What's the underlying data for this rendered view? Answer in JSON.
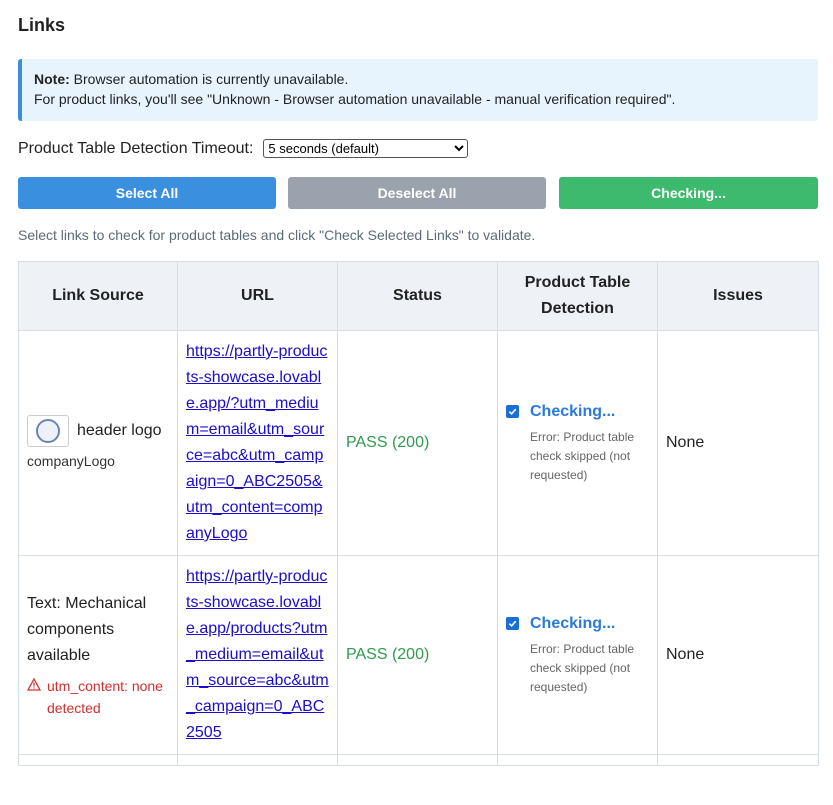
{
  "page": {
    "title": "Links"
  },
  "note": {
    "label": "Note:",
    "line1": "Browser automation is currently unavailable.",
    "line2": "For product links, you'll see \"Unknown - Browser automation unavailable - manual verification required\"."
  },
  "timeout": {
    "label": "Product Table Detection Timeout:",
    "selected": "5 seconds (default)"
  },
  "buttons": {
    "select_all": "Select All",
    "deselect_all": "Deselect All",
    "check": "Checking..."
  },
  "hint": "Select links to check for product tables and click \"Check Selected Links\" to validate.",
  "colors": {
    "primary": "#3b8fdf",
    "muted": "#9aa3ad",
    "success": "#3dba6e",
    "pass": "#2f9b4f",
    "error": "#d32f2f"
  },
  "table": {
    "headers": [
      "Link Source",
      "URL",
      "Status",
      "Product Table Detection",
      "Issues"
    ],
    "rows": [
      {
        "source_icon": "company-logo-image",
        "source_text": "header logo",
        "source_sub": "companyLogo",
        "warning": "",
        "url": "https://partly-products-showcase.lovable.app/?utm_medium=email&utm_source=abc&utm_campaign=0_ABC2505&utm_content=companyLogo",
        "status": "PASS (200)",
        "detect_label": "Checking...",
        "detect_error": "Error: Product table check skipped (not requested)",
        "issues": "None"
      },
      {
        "source_icon": "",
        "source_text": "Text: Mechanical components available",
        "source_sub": "",
        "warning": "utm_content: none detected",
        "url": "https://partly-products-showcase.lovable.app/products?utm_medium=email&utm_source=abc&utm_campaign=0_ABC2505",
        "status": "PASS (200)",
        "detect_label": "Checking...",
        "detect_error": "Error: Product table check skipped (not requested)",
        "issues": "None"
      }
    ]
  }
}
